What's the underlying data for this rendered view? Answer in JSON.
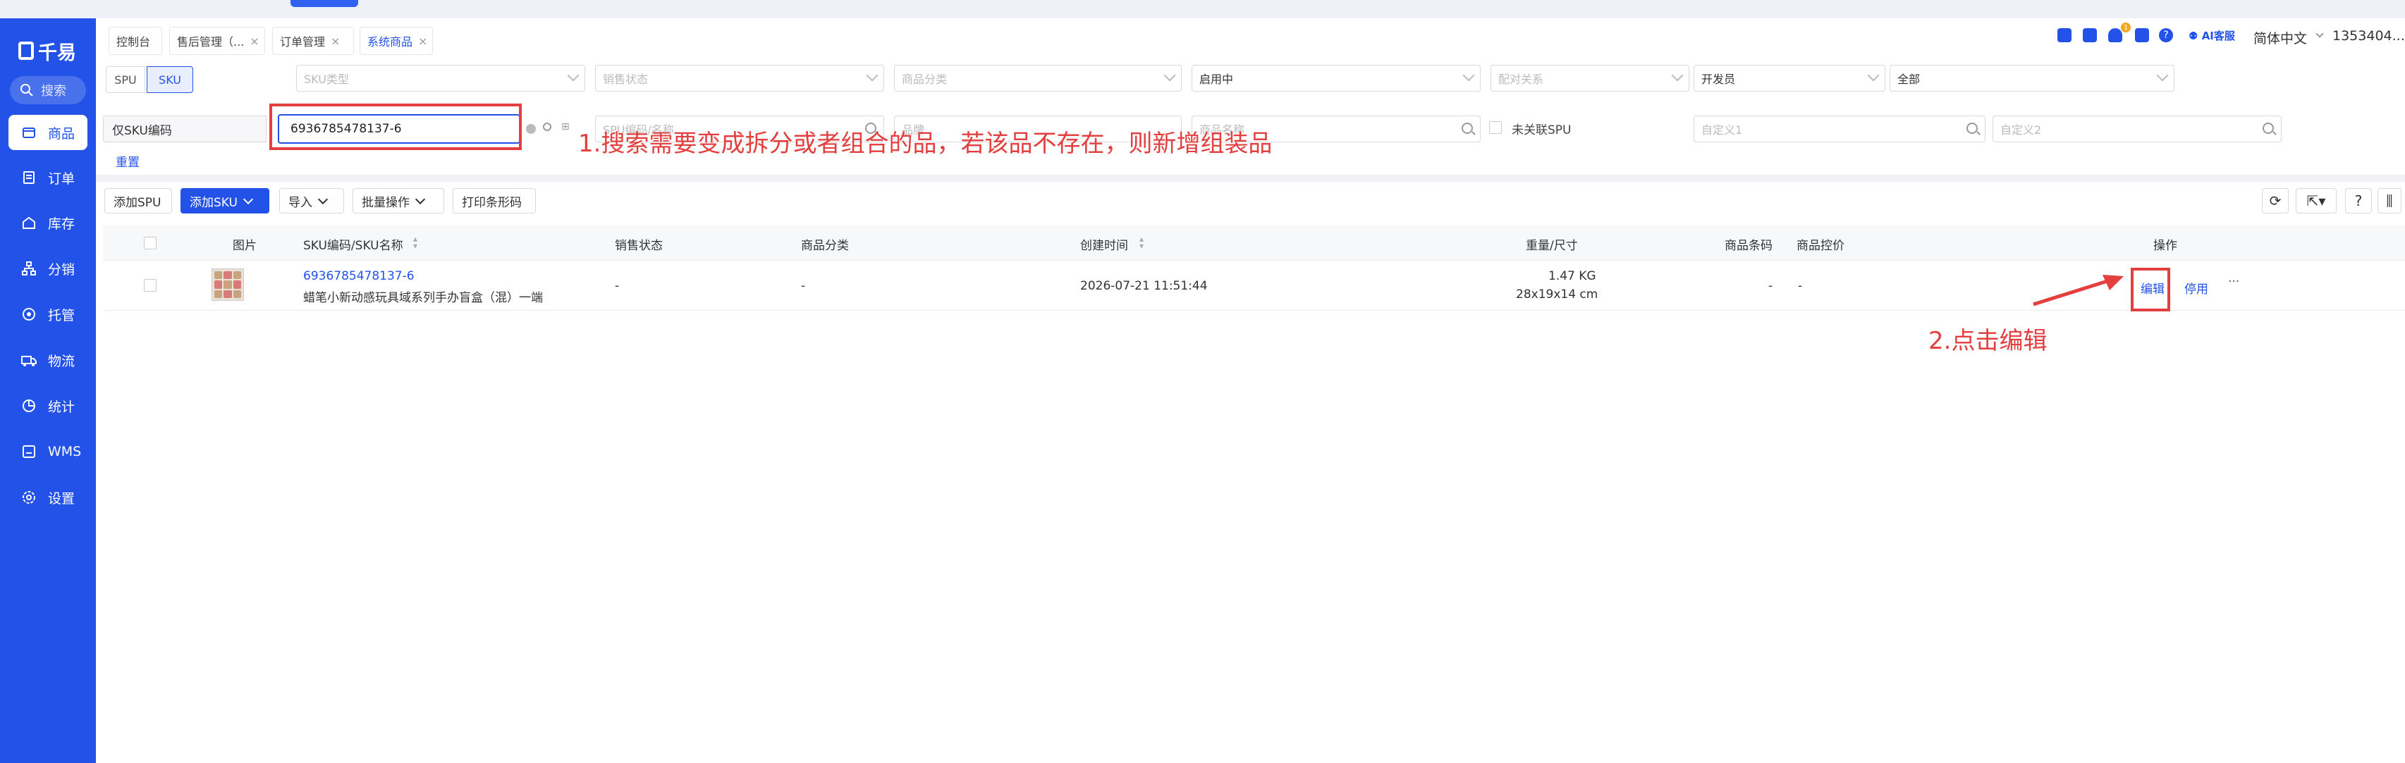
{
  "sidebar": {
    "logo": "千易",
    "search_label": "搜索",
    "items": [
      {
        "label": "商品",
        "icon": "goods-icon",
        "active": true
      },
      {
        "label": "订单",
        "icon": "order-icon"
      },
      {
        "label": "库存",
        "icon": "inventory-icon"
      },
      {
        "label": "分销",
        "icon": "distribution-icon"
      },
      {
        "label": "托管",
        "icon": "hosting-icon"
      },
      {
        "label": "物流",
        "icon": "truck-icon"
      },
      {
        "label": "统计",
        "icon": "pie-chart-icon"
      },
      {
        "label": "WMS",
        "icon": "warehouse-icon"
      },
      {
        "label": "设置",
        "icon": "gear-icon"
      }
    ]
  },
  "tabs": [
    {
      "label": "控制台"
    },
    {
      "label": "售后管理（..."
    },
    {
      "label": "订单管理"
    },
    {
      "label": "系统商品",
      "active": true
    }
  ],
  "header": {
    "ai_label": "AI客服",
    "language": "简体中文",
    "user": "1353404...",
    "notification_badge": "1"
  },
  "filters": {
    "spu_label": "SPU",
    "sku_label": "SKU",
    "sku_type_placeholder": "SKU类型",
    "sale_status_placeholder": "销售状态",
    "category_placeholder": "商品分类",
    "enabled_value": "启用中",
    "pairing_placeholder": "配对关系",
    "developer_value": "开发员",
    "all_value": "全部",
    "search_type": "仅SKU编码",
    "search_value": "6936785478137-6",
    "spu_code_placeholder": "SPU编码/名称",
    "brand_placeholder": "品牌",
    "name_placeholder": "商品名称",
    "unlinked_spu_label": "未关联SPU",
    "custom1_placeholder": "自定义1",
    "custom2_placeholder": "自定义2",
    "reset_label": "重置"
  },
  "toolbar": {
    "add_spu": "添加SPU",
    "add_sku": "添加SKU",
    "import": "导入",
    "batch": "批量操作",
    "print_barcode": "打印条形码"
  },
  "table": {
    "headers": {
      "image": "图片",
      "sku": "SKU编码/SKU名称",
      "sale_status": "销售状态",
      "category": "商品分类",
      "created": "创建时间",
      "weight_size": "重量/尺寸",
      "barcode": "商品条码",
      "price_control": "商品控价",
      "actions": "操作"
    },
    "rows": [
      {
        "sku_code": "6936785478137-6",
        "sku_name": "蜡笔小新动感玩具域系列手办盲盒（混）一端",
        "sale_status": "-",
        "category": "-",
        "created": "2026-07-21 11:51:44",
        "weight": "1.47 KG",
        "size": "28x19x14 cm",
        "barcode": "-",
        "price_control": "-",
        "edit": "编辑",
        "disable": "停用",
        "more": "···"
      }
    ]
  },
  "annotations": {
    "step1": "1.搜索需要变成拆分或者组合的品，若该品不存在，则新增组装品",
    "step2": "2.点击编辑",
    "color": "#e43f3f"
  },
  "colors": {
    "brand": "#2352e8"
  }
}
